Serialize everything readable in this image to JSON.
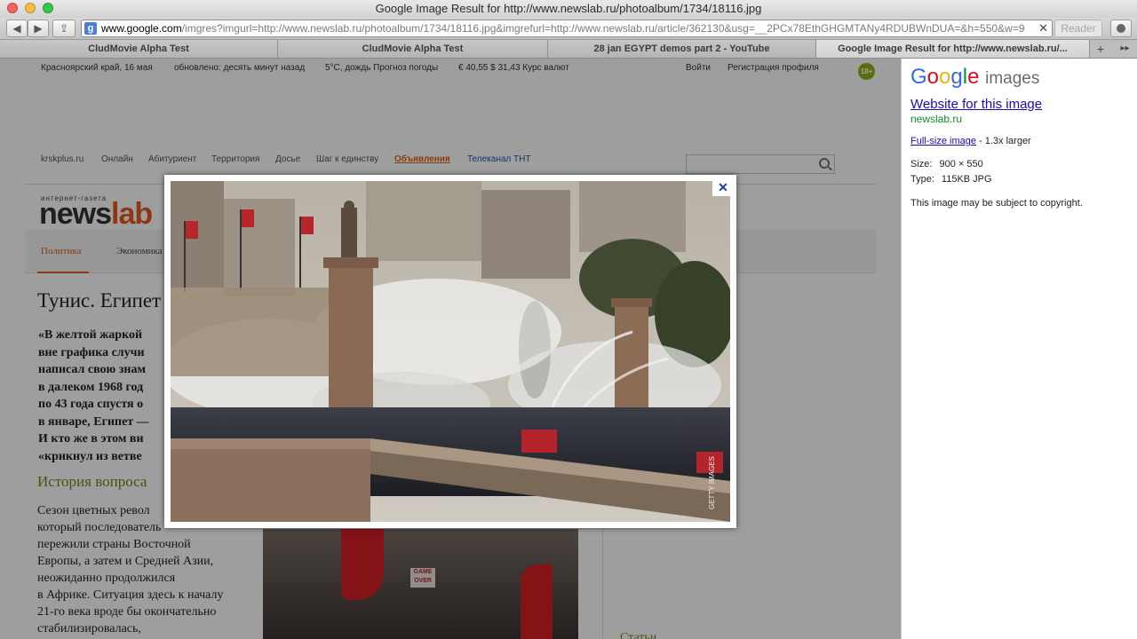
{
  "window": {
    "title": "Google Image Result for http://www.newslab.ru/photoalbum/1734/18116.jpg"
  },
  "toolbar": {
    "back": "◀",
    "forward": "▶",
    "share": "⇪",
    "url_host": "www.google.com",
    "url_rest": "/imgres?imgurl=http://www.newslab.ru/photoalbum/1734/18116.jpg&imgrefurl=http://www.newslab.ru/article/362130&usg=__2PCx78EthGHGMTANy4RDUBWnDUA=&h=550&w=90",
    "clear": "✕",
    "reader": "Reader"
  },
  "tabs": [
    {
      "label": "CludMovie Alpha Test"
    },
    {
      "label": "CludMovie Alpha Test"
    },
    {
      "label": "28 jan EGYPT demos part 2 - YouTube"
    },
    {
      "label": "Google Image Result for http://www.newslab.ru/..."
    }
  ],
  "tab_new": "+",
  "tab_list": "▸▸",
  "site": {
    "top": {
      "region": "Красноярский край, 16 мая",
      "updated": "обновлено: десять минут назад",
      "weather": "5°C, дождь Прогноз погоды",
      "rates": "€ 40,55 $ 31,43 Курс валют",
      "login": "Войти",
      "register": "Регистрация профиля",
      "age": "18+"
    },
    "nav": [
      "krskplus.ru",
      "Онлайн",
      "Абитуриент",
      "Территория",
      "Досье",
      "Шаг к единству",
      "Объявления",
      "Телеканал ТНТ"
    ],
    "logo_small": "интернет-газета",
    "logo_main": "news",
    "logo_accent": "lab",
    "sections": [
      "Политика",
      "Экономика"
    ],
    "article_title": "Тунис. Египет",
    "lead_lines": [
      "«В желтой жаркой",
      "вне графика случи",
      "написал свою знам",
      "в далеком 1968 год",
      "по 43 года спустя о",
      "в январе, Египет —",
      "И кто же в этом ви",
      "«крикнул из ветве"
    ],
    "subhead": "История вопроса",
    "body_lines": [
      "Сезон цветных револ",
      "который последователь",
      "пережили страны Восточной",
      "Европы, а затем и Средней Азии,",
      "неожиданно продолжился",
      "в Африке. Ситуация здесь к началу",
      "21-го века вроде бы окончательно",
      "стабилизировалась,"
    ],
    "sign_text": "GAME OVER",
    "bottom_word": "Статьи"
  },
  "modal": {
    "close": "✕",
    "image_alt": "Protest on a bridge in Cairo with tear gas and water cannons",
    "watermark": "GETTY IMAGES"
  },
  "panel": {
    "logo_letters": [
      {
        "ch": "G",
        "color": "#3369e8"
      },
      {
        "ch": "o",
        "color": "#d50f25"
      },
      {
        "ch": "o",
        "color": "#eeb211"
      },
      {
        "ch": "g",
        "color": "#3369e8"
      },
      {
        "ch": "l",
        "color": "#009925"
      },
      {
        "ch": "e",
        "color": "#d50f25"
      }
    ],
    "logo_suffix": "images",
    "website_link": "Website for this image",
    "domain": "newslab.ru",
    "full_size_link": "Full-size image",
    "full_size_suffix": "- 1.3x larger",
    "size_label": "Size:",
    "size_value": "900 × 550",
    "type_label": "Type:",
    "type_value": "115KB JPG",
    "copyright": "This image may be subject to copyright."
  },
  "colors": {
    "link": "#1a0dab",
    "domain_green": "#138a2f",
    "site_orange": "#d9601a",
    "site_green": "#6a8f1c"
  }
}
